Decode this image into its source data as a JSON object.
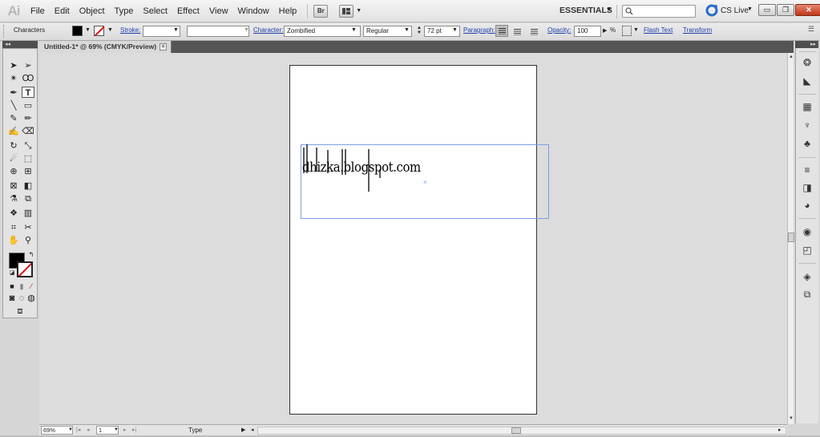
{
  "app": {
    "logo": "Ai",
    "menu": [
      "File",
      "Edit",
      "Object",
      "Type",
      "Select",
      "Effect",
      "View",
      "Window",
      "Help"
    ],
    "bridge_label": "Br",
    "workspace": "ESSENTIALS",
    "cslive_label": "CS Live",
    "search_placeholder": ""
  },
  "control_bar": {
    "panel_label": "Characters",
    "stroke_label": "Stroke:",
    "character_label": "Character:",
    "font_family": "Zombified",
    "font_style": "Regular",
    "font_size": "72 pt",
    "paragraph_label": "Paragraph:",
    "opacity_label": "Opacity:",
    "opacity_value": "100",
    "opacity_unit": "%",
    "flash_text_label": "Flash Text",
    "transform_label": "Transform"
  },
  "document": {
    "tab_title": "Untitled-1* @ 69% (CMYK/Preview)",
    "tab_close": "×",
    "text_content": "dhizka.blogspot.com"
  },
  "status_bar": {
    "zoom": "69%",
    "page": "1",
    "mode": "Type"
  },
  "colors": {
    "fill": "#000000",
    "stroke": "none",
    "selection": "#7b9ee6",
    "close_button": "#c0371a"
  },
  "icons": {
    "tools": [
      "selection-tool",
      "direct-selection-tool",
      "magic-wand-tool",
      "lasso-tool",
      "pen-tool",
      "type-tool",
      "line-segment-tool",
      "rectangle-tool",
      "paintbrush-tool",
      "pencil-tool",
      "blob-brush-tool",
      "eraser-tool",
      "rotate-tool",
      "scale-tool",
      "warp-tool",
      "free-transform-tool",
      "shape-builder-tool",
      "perspective-grid-tool",
      "mesh-tool",
      "gradient-tool",
      "eyedropper-tool",
      "blend-tool",
      "symbol-sprayer-tool",
      "column-graph-tool",
      "artboard-tool",
      "slice-tool",
      "hand-tool",
      "zoom-tool"
    ],
    "dock": [
      "color-guide-icon",
      "color-icon",
      "swatches-icon",
      "brushes-icon",
      "symbols-icon",
      "stroke-icon",
      "gradient-icon",
      "transparency-icon",
      "appearance-icon",
      "graphic-styles-icon",
      "layers-icon",
      "artboards-icon"
    ]
  }
}
